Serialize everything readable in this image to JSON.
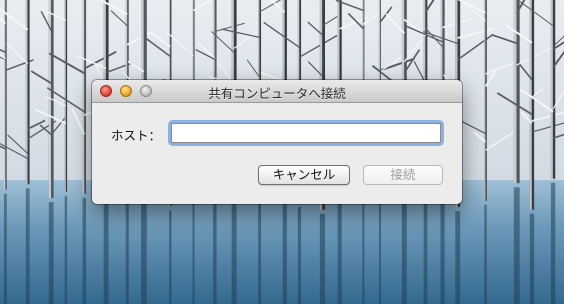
{
  "desktop": {
    "wallpaper": "snowy-birch-forest-blue-pond",
    "colors": {
      "sky": "#dfe6ec",
      "water_top": "#7fa7c2",
      "water_bottom": "#3d7097",
      "trunk": "#3a3c40"
    }
  },
  "dialog": {
    "title": "共有コンピュータへ接続",
    "window_controls": [
      "close-button",
      "minimize-button",
      "zoom-button"
    ],
    "host_label": "ホスト：",
    "host_value": "",
    "host_placeholder": "",
    "buttons": {
      "cancel": "キャンセル",
      "connect": "接続"
    },
    "colors": {
      "focus_ring": "#6ca0dc",
      "disabled_text": "#9c9c9c"
    }
  }
}
